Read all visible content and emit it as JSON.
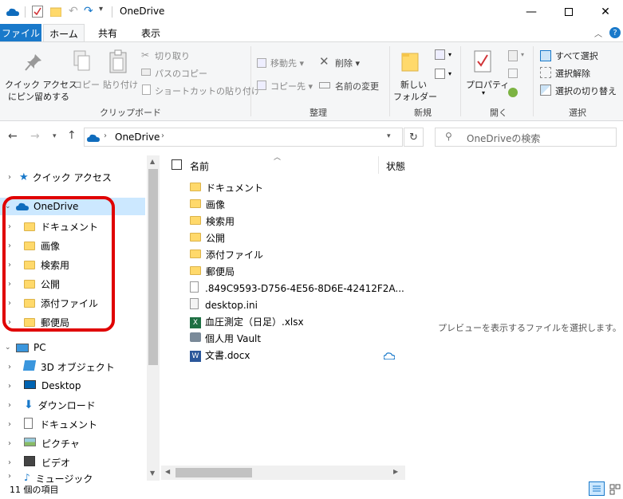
{
  "window": {
    "title": "OneDrive"
  },
  "tabs": {
    "file": "ファイル",
    "home": "ホーム",
    "share": "共有",
    "view": "表示"
  },
  "ribbon": {
    "pin_line1": "クイック アクセス",
    "pin_line2": "にピン留めする",
    "copy": "コピー",
    "paste": "貼り付け",
    "cut": "切り取り",
    "copy_path": "パスのコピー",
    "paste_shortcut": "ショートカットの貼り付け",
    "clipboard_group": "クリップボード",
    "move_to": "移動先",
    "copy_to": "コピー先",
    "delete": "削除",
    "rename": "名前の変更",
    "organize_group": "整理",
    "new_folder_line1": "新しい",
    "new_folder_line2": "フォルダー",
    "new_group": "新規",
    "properties": "プロパティ",
    "open_group": "開く",
    "select_all": "すべて選択",
    "select_none": "選択解除",
    "invert_selection": "選択の切り替え",
    "select_group": "選択"
  },
  "address": {
    "crumb": "OneDrive",
    "search_placeholder": "OneDriveの検索"
  },
  "nav": {
    "quick_access": "クイック アクセス",
    "onedrive": "OneDrive",
    "onedrive_children": [
      "ドキュメント",
      "画像",
      "検索用",
      "公開",
      "添付ファイル",
      "郵便局"
    ],
    "pc": "PC",
    "pc_children": [
      "3D オブジェクト",
      "Desktop",
      "ダウンロード",
      "ドキュメント",
      "ピクチャ",
      "ビデオ",
      "ミュージック"
    ]
  },
  "columns": {
    "name": "名前",
    "status": "状態"
  },
  "files": [
    {
      "name": "ドキュメント",
      "type": "folder"
    },
    {
      "name": "画像",
      "type": "folder"
    },
    {
      "name": "検索用",
      "type": "folder"
    },
    {
      "name": "公開",
      "type": "folder"
    },
    {
      "name": "添付ファイル",
      "type": "folder"
    },
    {
      "name": "郵便局",
      "type": "folder"
    },
    {
      "name": ".849C9593-D756-4E56-8D6E-42412F2A...",
      "type": "file"
    },
    {
      "name": "desktop.ini",
      "type": "ini"
    },
    {
      "name": "血圧測定（日足）.xlsx",
      "type": "excel"
    },
    {
      "name": "個人用 Vault",
      "type": "vault"
    },
    {
      "name": "文書.docx",
      "type": "word"
    }
  ],
  "preview": {
    "message": "プレビューを表示するファイルを選択します。"
  },
  "status": {
    "item_count": "11 個の項目"
  },
  "colors": {
    "accent": "#1979ca",
    "highlight": "#e00000",
    "selection": "#cce8ff"
  }
}
